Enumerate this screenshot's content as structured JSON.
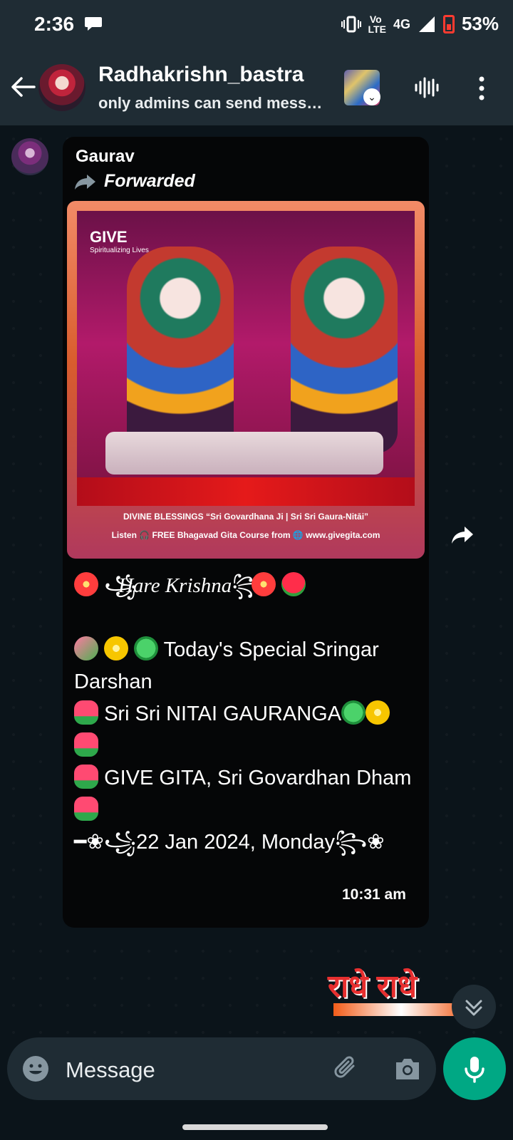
{
  "status_bar": {
    "time": "2:36",
    "network_top": "Vo ",
    "network_bottom": "LTE",
    "network_type": "4G",
    "battery": "53%"
  },
  "header": {
    "title": "Radhakrishn_bastra",
    "subtitle": "only admins can send mess…"
  },
  "message": {
    "sender": "Gaurav",
    "forwarded_label": "Forwarded",
    "image": {
      "logo": "GIVE",
      "logo_sub": "Spiritualizing Lives",
      "caption_line1": "DIVINE BLESSINGS “Sri Govardhana Ji | Sri Sri Gaura-Nitāi”",
      "caption_line2": "Listen 🎧 FREE Bhagavad Gita Course from 🌐 www.givegita.com"
    },
    "hare_krishna": "Hare Krishna",
    "special_line": "Today's Special Sringar Darshan",
    "line_nitai": "Sri Sri NITAI GAURANGA",
    "line_give": "GIVE GITA, Sri Govardhan Dham",
    "date_line": "22 Jan 2024, Monday",
    "time": "10:31 am"
  },
  "sticker": {
    "text": "राधे राधे"
  },
  "input": {
    "placeholder": "Message"
  },
  "colors": {
    "app_bar": "#1f2c34",
    "chat_background": "#0b141a",
    "bubble": "#050607",
    "accent_green": "#00a884"
  },
  "icons": [
    "chat-bubble-icon",
    "vibrate-icon",
    "signal-icon",
    "battery-icon",
    "back-arrow-icon",
    "group-avatar",
    "voice-wave-icon",
    "more-options-icon",
    "forward-icon",
    "share-icon",
    "scroll-down-icon",
    "emoji-icon",
    "attach-icon",
    "camera-icon",
    "mic-icon"
  ]
}
